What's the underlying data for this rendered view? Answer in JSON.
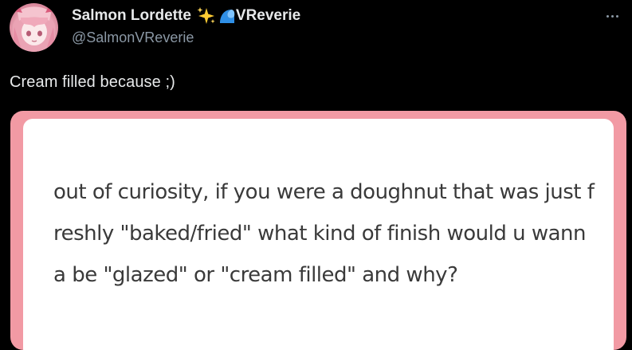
{
  "author": {
    "display_name": "Salmon Lordette",
    "name_suffix": "VReverie",
    "handle": "@SalmonVReverie",
    "avatar_icon": "anime-avatar-pink-hair",
    "badges": [
      "sparkles-icon",
      "water-wave-icon"
    ]
  },
  "more_menu": {
    "icon": "more-horizontal-icon"
  },
  "tweet": {
    "text": "Cream filled because ;)"
  },
  "media": {
    "question_text": "out of curiosity, if you were a doughnut that was just freshly \"baked/fried\" what kind of finish would u wanna be \"glazed\" or \"cream filled\" and why?",
    "frame_color": "#f29aa4",
    "card_color": "#ffffff"
  },
  "colors": {
    "background": "#000000",
    "primary_text": "#e7e9ea",
    "secondary_text": "#8b98a5"
  }
}
